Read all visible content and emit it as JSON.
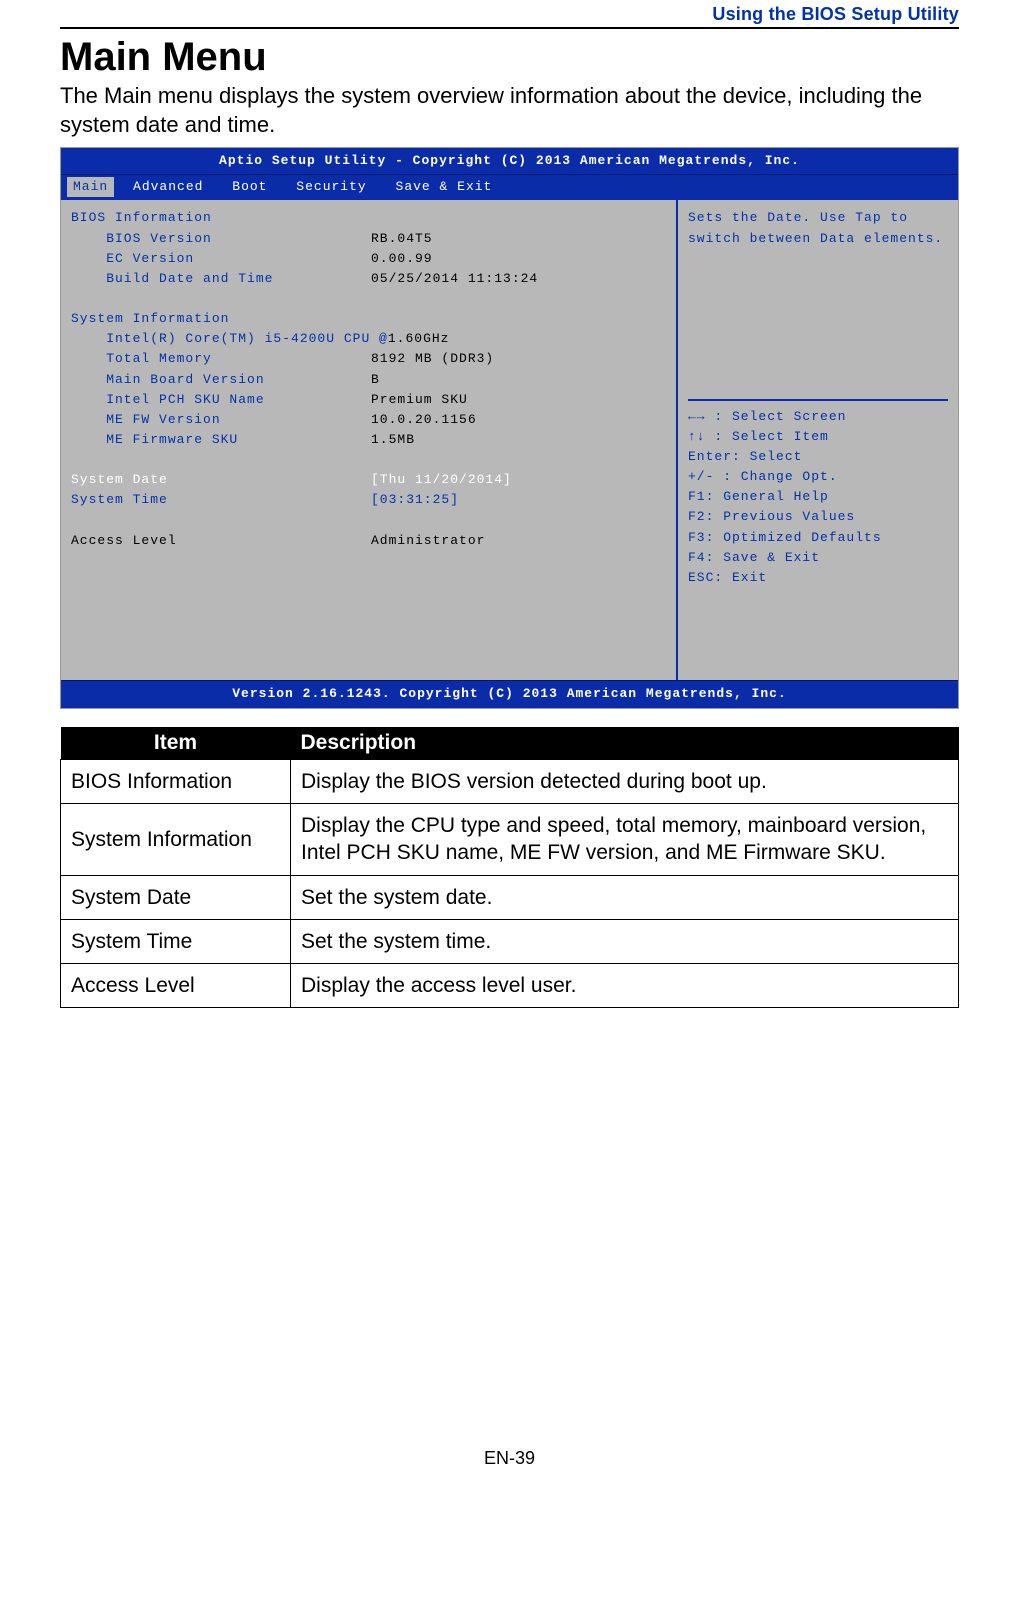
{
  "header": {
    "breadcrumb": "Using the BIOS Setup Utility"
  },
  "title": "Main Menu",
  "intro": "The Main menu displays the system overview information about the device, including the system date and time.",
  "bios": {
    "titlebar": "Aptio Setup Utility - Copyright (C) 2013 American Megatrends, Inc.",
    "tabs": [
      "Main",
      "Advanced",
      "Boot",
      "Security",
      "Save & Exit"
    ],
    "sections": {
      "bios_info_header": "BIOS Information",
      "bios_info": [
        {
          "label": "    BIOS Version",
          "value": "RB.04T5"
        },
        {
          "label": "    EC Version",
          "value": "0.00.99"
        },
        {
          "label": "    Build Date and Time",
          "value": "05/25/2014 11:13:24"
        }
      ],
      "sys_info_header": "System Information",
      "sys_info": [
        {
          "label": "    Intel(R) Core(TM) i5-4200U CPU @",
          "value": "1.60GHz"
        },
        {
          "label": "    Total Memory",
          "value": "8192 MB (DDR3)"
        },
        {
          "label": "    Main Board Version",
          "value": "B"
        },
        {
          "label": "    Intel PCH SKU Name",
          "value": "Premium SKU"
        },
        {
          "label": "    ME FW Version",
          "value": "10.0.20.1156"
        },
        {
          "label": "    ME Firmware SKU",
          "value": "1.5MB"
        }
      ],
      "system_date": {
        "label": "System Date",
        "value": "[Thu 11/20/2014]"
      },
      "system_time": {
        "label": "System Time",
        "value": "[03:31:25]"
      },
      "access_level": {
        "label": "Access Level",
        "value": "Administrator"
      }
    },
    "help_text": "Sets the Date. Use Tap to switch between Data elements.",
    "keys": [
      "←→ : Select Screen",
      "↑↓ : Select Item",
      "Enter: Select",
      "+/- : Change Opt.",
      "F1: General Help",
      "F2: Previous Values",
      "F3: Optimized Defaults",
      "F4: Save & Exit",
      "ESC: Exit"
    ],
    "footer": "Version 2.16.1243. Copyright (C) 2013 American Megatrends, Inc."
  },
  "table": {
    "headers": {
      "item": "Item",
      "desc": "Description"
    },
    "rows": [
      {
        "item": "BIOS Information",
        "desc": "Display the BIOS version detected during boot up."
      },
      {
        "item": "System Information",
        "desc": "Display the CPU type and speed, total memory, mainboard version, Intel PCH SKU name, ME FW version, and ME Firmware SKU."
      },
      {
        "item": "System Date",
        "desc": "Set the system date."
      },
      {
        "item": "System Time",
        "desc": "Set the system time."
      },
      {
        "item": "Access Level",
        "desc": "Display the access level user."
      }
    ]
  },
  "page_number": "EN-39"
}
